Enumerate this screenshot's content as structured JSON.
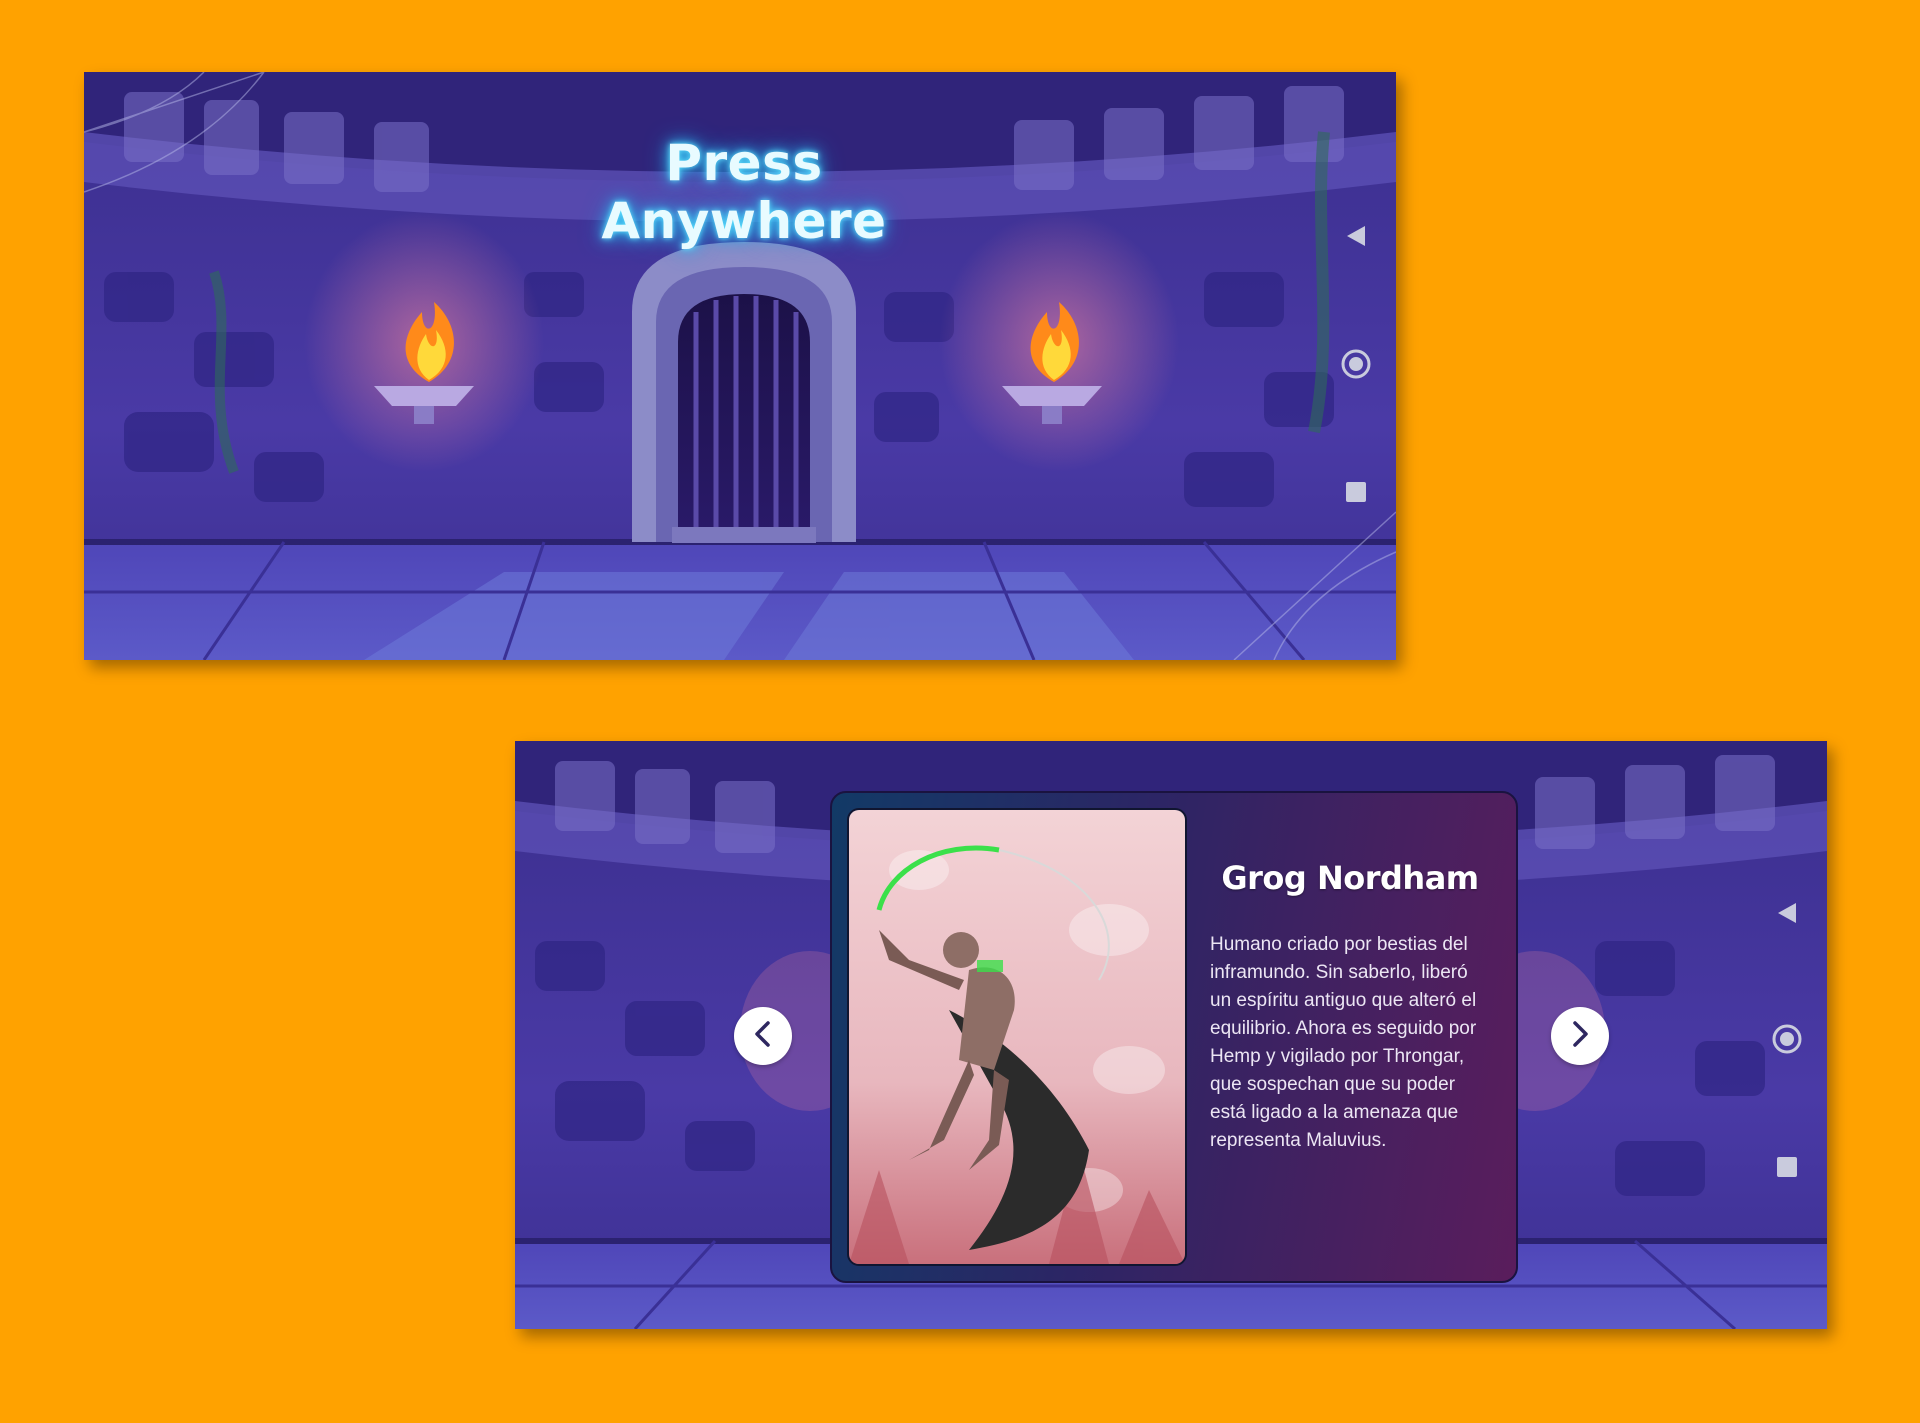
{
  "colors": {
    "background": "#FFA200",
    "title_glow": "#36C4F5",
    "nav_icon": "#C9CBDD",
    "arrow_icon": "#2E2760"
  },
  "start_screen": {
    "title": "Press Anywhere",
    "nav_bar": {
      "icons": [
        "back-triangle-icon",
        "home-circle-icon",
        "recents-square-icon"
      ]
    }
  },
  "character_screen": {
    "character": {
      "name": "Grog Nordham",
      "description": "Humano criado por bestias del inframundo. Sin saberlo, liberó un espíritu antiguo que alteró el equilibrio. Ahora es seguido por Hemp y vigilado por Throngar, que sospechan que su poder está ligado a la amenaza que representa Maluvius."
    },
    "prev_icon": "chevron-left-icon",
    "next_icon": "chevron-right-icon",
    "nav_bar": {
      "icons": [
        "back-triangle-icon",
        "home-circle-icon",
        "recents-square-icon"
      ]
    }
  }
}
